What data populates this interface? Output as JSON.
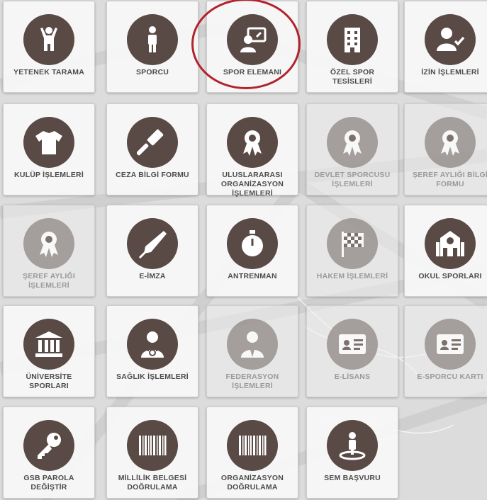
{
  "tiles": [
    {
      "label": "YETENEK TARAMA",
      "icon": "person-arms-up-icon",
      "active": true
    },
    {
      "label": "SPORCU",
      "icon": "person-standing-icon",
      "active": true
    },
    {
      "label": "SPOR ELEMANI",
      "icon": "presenter-board-icon",
      "active": true
    },
    {
      "label": "ÖZEL SPOR\nTESİSLERİ",
      "icon": "building-icon",
      "active": true
    },
    {
      "label": "İZİN İŞLEMLERİ",
      "icon": "user-check-icon",
      "active": true
    },
    {
      "label": "KULÜP İŞLEMLERİ",
      "icon": "tshirt-icon",
      "active": true
    },
    {
      "label": "CEZA BİLGİ FORMU",
      "icon": "gavel-icon",
      "active": true
    },
    {
      "label": "ULUSLARARASI\nORGANİZASYON\nİŞLEMLERİ",
      "icon": "award-ribbon-icon",
      "active": true
    },
    {
      "label": "DEVLET SPORCUSU\nİŞLEMLERİ",
      "icon": "award-ribbon-icon",
      "active": false
    },
    {
      "label": "ŞEREF AYLIĞI BİLGİ\nFORMU",
      "icon": "award-ribbon-icon",
      "active": false
    },
    {
      "label": "ŞEREF AYLIĞI\nİŞLEMLERİ",
      "icon": "award-ribbon-icon",
      "active": false
    },
    {
      "label": "E-İMZA",
      "icon": "pen-nib-icon",
      "active": true
    },
    {
      "label": "ANTRENMAN",
      "icon": "stopwatch-icon",
      "active": true
    },
    {
      "label": "HAKEM İŞLEMLERİ",
      "icon": "checkered-flag-icon",
      "active": false
    },
    {
      "label": "OKUL SPORLARI",
      "icon": "school-icon",
      "active": true
    },
    {
      "label": "ÜNİVERSİTE\nSPORLARI",
      "icon": "university-icon",
      "active": true
    },
    {
      "label": "SAĞLIK İŞLEMLERİ",
      "icon": "doctor-icon",
      "active": true
    },
    {
      "label": "FEDERASYON\nİŞLEMLERİ",
      "icon": "user-tie-icon",
      "active": false
    },
    {
      "label": "E-LİSANS",
      "icon": "id-card-icon",
      "active": false
    },
    {
      "label": "E-SPORCU KARTI",
      "icon": "id-card-icon",
      "active": false
    },
    {
      "label": "GSB PAROLA\nDEĞİŞTİR",
      "icon": "key-icon",
      "active": true
    },
    {
      "label": "MİLLİLİK BELGESİ\nDOĞRULAMA",
      "icon": "barcode-icon",
      "active": true
    },
    {
      "label": "ORGANİZASYON\nDOĞRULAMA",
      "icon": "barcode-icon",
      "active": true
    },
    {
      "label": "SEM BAŞVURU",
      "icon": "person-location-icon",
      "active": true
    }
  ],
  "highlighted_tile": "SPOR ELEMANI",
  "colors": {
    "icon_circle": "#5a4a45",
    "label": "#4d4d4d",
    "highlight_ring": "#b2232c"
  }
}
